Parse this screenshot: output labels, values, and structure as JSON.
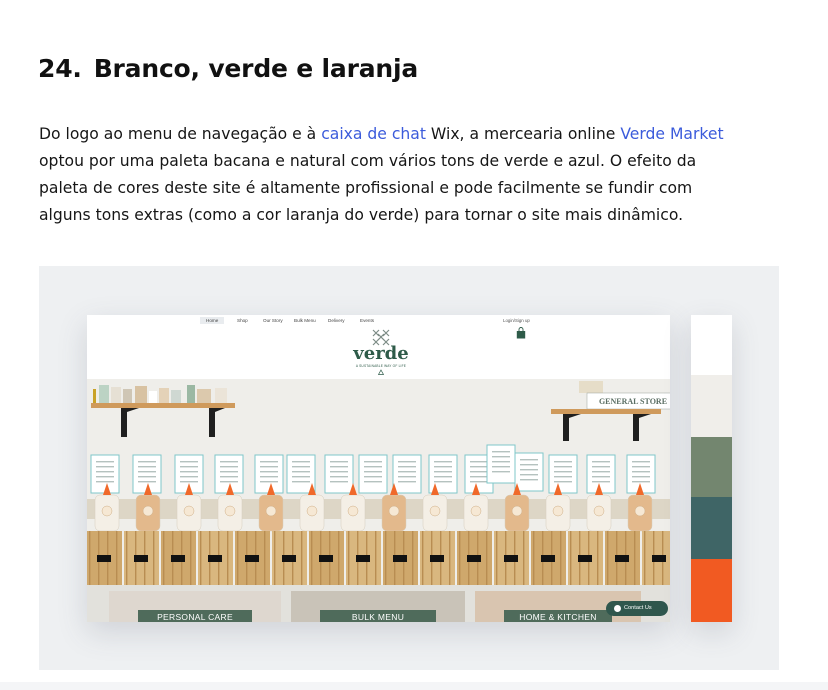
{
  "article": {
    "heading_number": "24.",
    "heading_title": "Branco, verde e laranja",
    "paragraph": {
      "l1_a": "Do logo ao menu de navegação e à ",
      "l1_link1": "caixa de chat",
      "l1_b": " Wix, a mercearia online ",
      "l1_link2": "Verde Market",
      "l2": "optou por uma paleta bacana e natural com vários tons de verde e azul. O efeito da",
      "l3": "paleta de cores deste site é altamente profissional e pode facilmente se fundir com",
      "l4": "alguns tons extras (como a cor laranja do verde) para tornar o site mais dinâmico."
    },
    "link_color": "#3b5bdb"
  },
  "screenshot": {
    "nav": [
      "Home",
      "Shop",
      "Our Story",
      "Bulk Menu",
      "Delivery",
      "Events"
    ],
    "login": "Login/Sign up",
    "logo_word": "verde",
    "logo_tagline": "A SUSTAINABLE WAY OF LIFE",
    "store_sign": "GENERAL STORE",
    "categories": [
      "PERSONAL CARE",
      "BULK MENU",
      "HOME & KITCHEN"
    ],
    "chat_label": "Contact Us",
    "brand_green": "#2e5b49"
  },
  "palette": {
    "colors": [
      "#ffffff",
      "#f0eeea",
      "#73866f",
      "#3f6566",
      "#f15a22"
    ]
  }
}
